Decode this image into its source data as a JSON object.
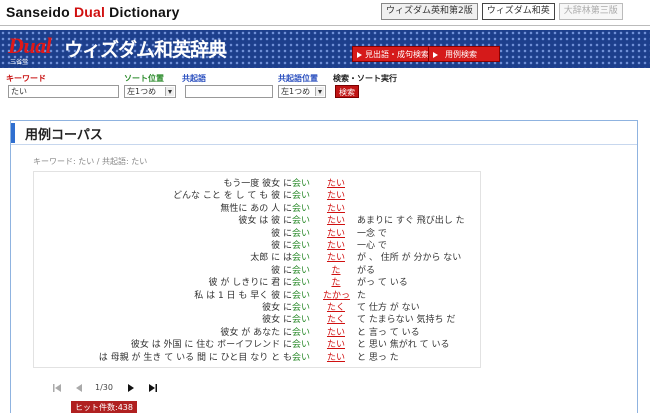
{
  "header": {
    "brand_prefix": "Sanseido ",
    "brand_dual": "Dual",
    "brand_suffix": " Dictionary",
    "tabs": [
      {
        "label": "ウィズダム英和第2版"
      },
      {
        "label": "ウィズダム和英"
      },
      {
        "label": "大辞林第三版"
      }
    ]
  },
  "banner": {
    "logo_dual": "Dual",
    "logo_title": "ウィズダム和英辞典",
    "logo_sub": "三省堂",
    "btn_headword": "見出語・成句検索",
    "btn_example": "用例検索"
  },
  "search": {
    "keyword_label": "キーワード",
    "keyword_value": "たい",
    "sort_label": "ソート位置",
    "sort_value": "左1つめ",
    "coloc_label": "共起語",
    "coloc_value": "",
    "coloc_pos_label": "共起語位置",
    "coloc_pos_value": "左1つめ",
    "exec_label": "検索・ソート実行",
    "exec_button": "検索"
  },
  "panel": {
    "title": "用例コーパス",
    "breadcrumb": "キーワード: たい / 共起語: たい"
  },
  "corpus": {
    "rows": [
      {
        "pre": "もう一度 彼女 に",
        "col": "会い",
        "kw": "たい",
        "post": ""
      },
      {
        "pre": "どんな こと を し て も 彼 に",
        "col": "会い",
        "kw": "たい",
        "post": ""
      },
      {
        "pre": "無性に あの 人 に",
        "col": "会い",
        "kw": "たい",
        "post": ""
      },
      {
        "pre": "彼女 は 彼 に",
        "col": "会い",
        "kw": "たい",
        "post": "あまりに すぐ 飛び出し た"
      },
      {
        "pre": "彼 に",
        "col": "会い",
        "kw": "たい",
        "post": "一念 で"
      },
      {
        "pre": "彼 に",
        "col": "会い",
        "kw": "たい",
        "post": "一心 で"
      },
      {
        "pre": "太郎 に は",
        "col": "会い",
        "kw": "たい",
        "post": "が 、 住所 が 分から ない"
      },
      {
        "pre": "彼 に",
        "col": "会い",
        "kw": "た",
        "post": "がる"
      },
      {
        "pre": "彼 が しきりに 君 に",
        "col": "会い",
        "kw": "た",
        "post": "がっ て いる"
      },
      {
        "pre": "私 は 1 日 も 早く 彼 に",
        "col": "会い",
        "kw": "たかっ",
        "post": "た"
      },
      {
        "pre": "彼女 に",
        "col": "会い",
        "kw": "たく",
        "post": "て 仕方 が ない"
      },
      {
        "pre": "彼女 に",
        "col": "会い",
        "kw": "たく",
        "post": "て たまらない 気持ち だ"
      },
      {
        "pre": "彼女 が あなた に",
        "col": "会い",
        "kw": "たい",
        "post": "と 言っ て いる"
      },
      {
        "pre": "彼女 は 外国 に 住む ボーイフレンド に",
        "col": "会い",
        "kw": "たい",
        "post": "と 思い 焦がれ て いる"
      },
      {
        "pre": "は 母親 が 生き て いる 間 に ひと目 なり と も",
        "col": "会い",
        "kw": "たい",
        "post": "と 思っ た"
      }
    ]
  },
  "pager": {
    "count": "1/30",
    "hits": "ヒット件数:438"
  },
  "colors": {
    "banner_blue": "#1d3f8c",
    "accent_red": "#d01010",
    "collocate_green": "#2a8a2a",
    "panel_border": "#8fb3e0"
  }
}
